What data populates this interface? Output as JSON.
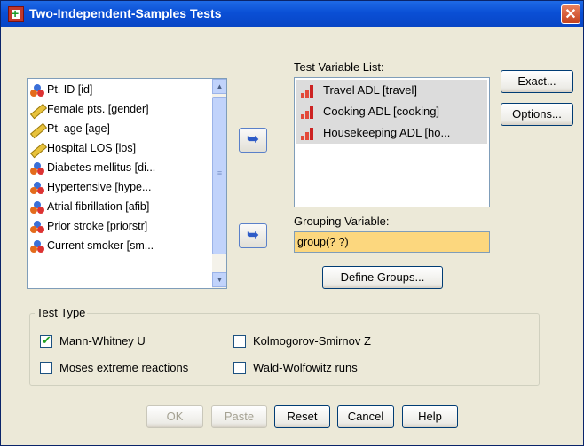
{
  "window": {
    "title": "Two-Independent-Samples Tests",
    "close_glyph": "✕"
  },
  "source_list": {
    "items": [
      {
        "label": "Pt. ID [id]",
        "icon": "nominal-icon"
      },
      {
        "label": "Female pts. [gender]",
        "icon": "scale-icon"
      },
      {
        "label": "Pt. age [age]",
        "icon": "scale-icon"
      },
      {
        "label": "Hospital LOS [los]",
        "icon": "scale-icon"
      },
      {
        "label": "Diabetes mellitus [di...",
        "icon": "nominal-icon"
      },
      {
        "label": "Hypertensive [hype...",
        "icon": "nominal-icon"
      },
      {
        "label": "Atrial fibrillation [afib]",
        "icon": "nominal-icon"
      },
      {
        "label": "Prior stroke [priorstr]",
        "icon": "nominal-icon"
      },
      {
        "label": "Current smoker [sm...",
        "icon": "nominal-icon"
      }
    ],
    "scroll_up": "▲",
    "scroll_down": "▼",
    "thumb_grip": "≡"
  },
  "arrow_glyph": "➥",
  "test_variables": {
    "label": "Test Variable List:",
    "items": [
      {
        "label": "Travel ADL [travel]"
      },
      {
        "label": "Cooking ADL [cooking]"
      },
      {
        "label": "Housekeeping ADL [ho..."
      }
    ]
  },
  "grouping": {
    "label": "Grouping Variable:",
    "value": "group(? ?)"
  },
  "buttons": {
    "exact": "Exact...",
    "options": "Options...",
    "define_groups": "Define Groups...",
    "ok": "OK",
    "paste": "Paste",
    "reset": "Reset",
    "cancel": "Cancel",
    "help": "Help"
  },
  "test_type": {
    "title": "Test Type",
    "mann_whitney": {
      "label": "Mann-Whitney U",
      "checked": true
    },
    "kolmogorov": {
      "label": "Kolmogorov-Smirnov Z",
      "checked": false
    },
    "moses": {
      "label": "Moses extreme reactions",
      "checked": false
    },
    "wald": {
      "label": "Wald-Wolfowitz runs",
      "checked": false
    }
  }
}
